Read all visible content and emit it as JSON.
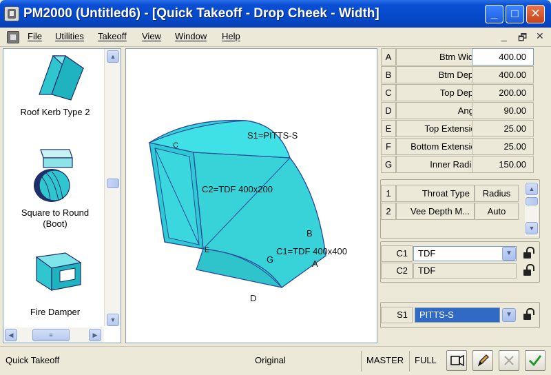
{
  "window": {
    "title": "PM2000 (Untitled6) - [Quick Takeoff - Drop Cheek - Width]",
    "controls": {
      "minimize": "_",
      "maximize": "□",
      "close": "✕"
    }
  },
  "menu": {
    "items": [
      "File",
      "Utilities",
      "Takeoff",
      "View",
      "Window",
      "Help"
    ],
    "mdi_controls": [
      "_",
      "🗗",
      "✕"
    ]
  },
  "library": {
    "items": [
      {
        "label": "Roof Kerb Type 2"
      },
      {
        "label": "Square to Round\n(Boot)"
      },
      {
        "label": "Fire Damper"
      }
    ]
  },
  "drawing": {
    "labels": {
      "s1": "S1=PITTS-S",
      "c2": "C2=TDF 400x200",
      "c1": "C1=TDF 400x400",
      "a": "A",
      "b": "B",
      "c": "C",
      "d": "D",
      "e": "E",
      "g": "G"
    },
    "fill_color": "#33d6dc",
    "line_color": "#2a4a9c"
  },
  "dimensions": [
    {
      "key": "A",
      "name": "Btm Width",
      "value": "400.00"
    },
    {
      "key": "B",
      "name": "Btm Depth",
      "value": "400.00"
    },
    {
      "key": "C",
      "name": "Top Depth",
      "value": "200.00"
    },
    {
      "key": "D",
      "name": "Angle",
      "value": "90.00"
    },
    {
      "key": "E",
      "name": "Top Extension",
      "value": "25.00"
    },
    {
      "key": "F",
      "name": "Bottom Extension",
      "value": "25.00"
    },
    {
      "key": "G",
      "name": "Inner Radius",
      "value": "150.00"
    }
  ],
  "options": [
    {
      "key": "1",
      "name": "Throat Type",
      "value": "Radius"
    },
    {
      "key": "2",
      "name": "Vee Depth M...",
      "value": "Auto"
    }
  ],
  "connectors": [
    {
      "key": "C1",
      "value": "TDF"
    },
    {
      "key": "C2",
      "value": "TDF"
    }
  ],
  "seam": {
    "key": "S1",
    "value": "PITTS-S"
  },
  "status": {
    "mode": "Quick Takeoff",
    "view": "Original",
    "scope": "MASTER",
    "detail": "FULL"
  }
}
